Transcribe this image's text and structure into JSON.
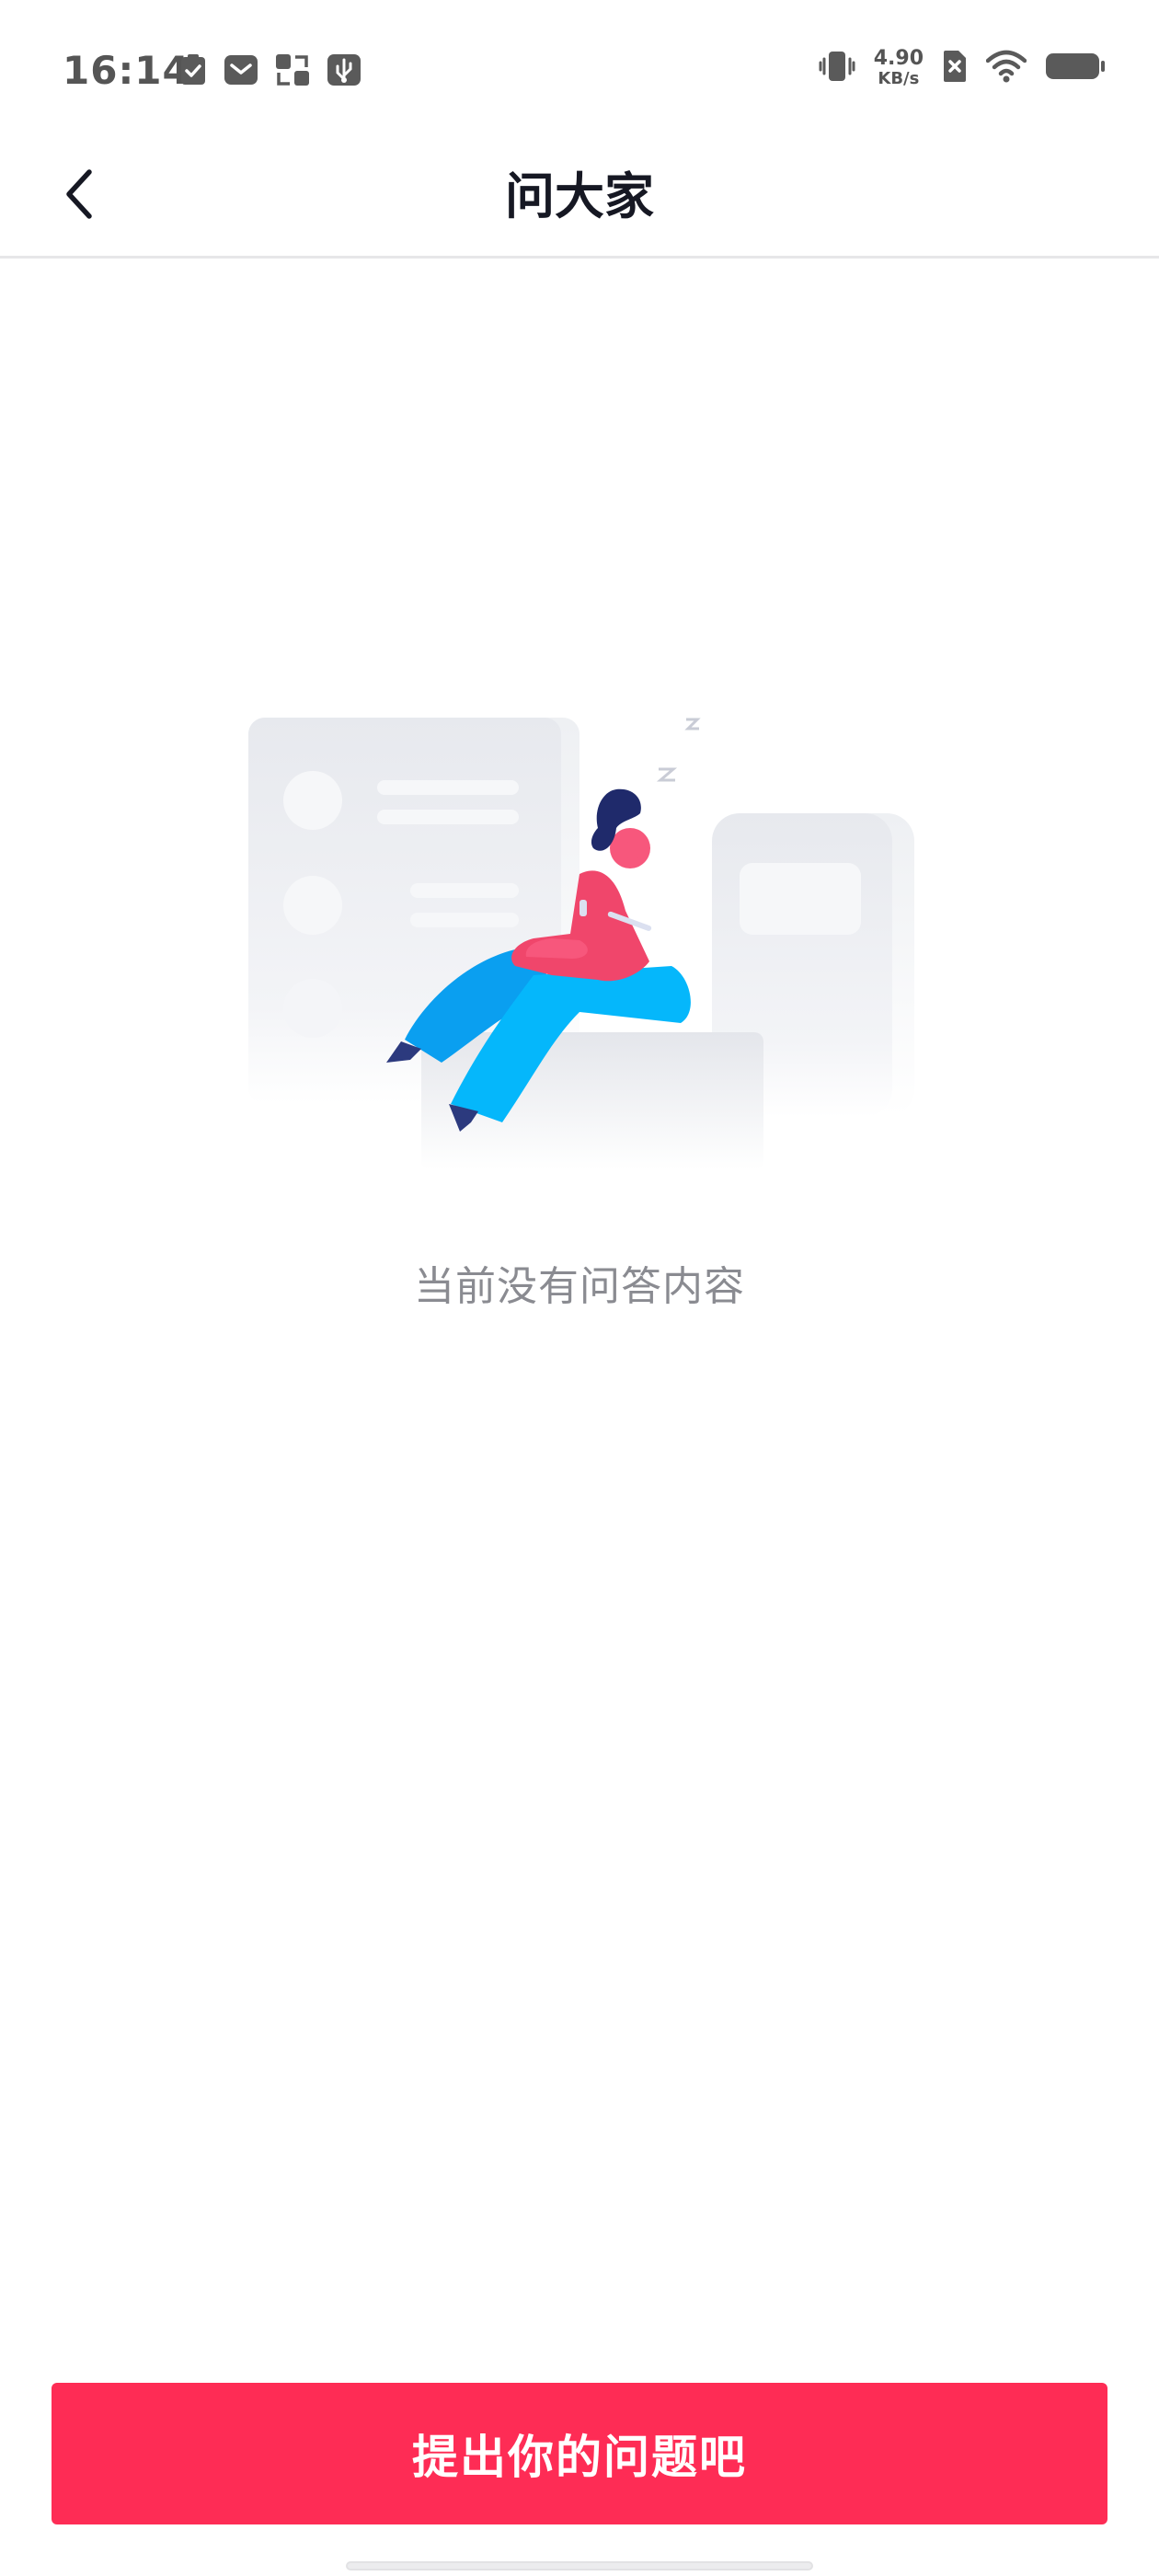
{
  "status_bar": {
    "time": "16:14",
    "left_icons": [
      "task-check-icon",
      "mail-icon",
      "app-switch-icon",
      "usb-debug-icon"
    ],
    "net_speed_value": "4.90",
    "net_speed_unit": "KB/s",
    "right_icons": [
      "vibrate-icon",
      "sim-none-icon",
      "wifi-icon",
      "battery-icon"
    ]
  },
  "nav": {
    "title": "问大家",
    "back_icon": "chevron-left-icon"
  },
  "empty_state": {
    "message": "当前没有问答内容",
    "illustration": "person-relaxing-with-phone"
  },
  "action": {
    "ask_label": "提出你的问题吧"
  },
  "colors": {
    "primary": "#fe2c55",
    "title_text": "#161823",
    "secondary_text": "#8a8b91",
    "divider": "#e6e6e8"
  }
}
